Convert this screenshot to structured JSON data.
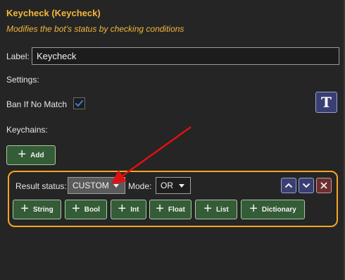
{
  "header": {
    "title": "Keycheck (Keycheck)",
    "subtitle": "Modifies the bot's status by checking conditions"
  },
  "form": {
    "label_caption": "Label:",
    "label_value": "Keycheck",
    "settings_caption": "Settings:",
    "ban_if_no_match_caption": "Ban If No Match",
    "ban_if_no_match_checked": true,
    "keychains_caption": "Keychains:",
    "add_button_label": "Add",
    "text_toggle_label": "T"
  },
  "keychain": {
    "result_status_caption": "Result status:",
    "result_status_value": "CUSTOM",
    "mode_caption": "Mode:",
    "mode_value": "OR",
    "buttons": [
      "String",
      "Bool",
      "Int",
      "Float",
      "List",
      "Dictionary"
    ],
    "move_up_icon": "chevron-up-icon",
    "move_down_icon": "chevron-down-icon",
    "remove_icon": "close-icon"
  },
  "colors": {
    "accent": "#f5b73b",
    "highlight_box": "#f5a623",
    "annotation_arrow": "#e01010",
    "green_button": "#345c36",
    "blue_button": "#3a3f72",
    "red_button": "#6b2f2f"
  }
}
